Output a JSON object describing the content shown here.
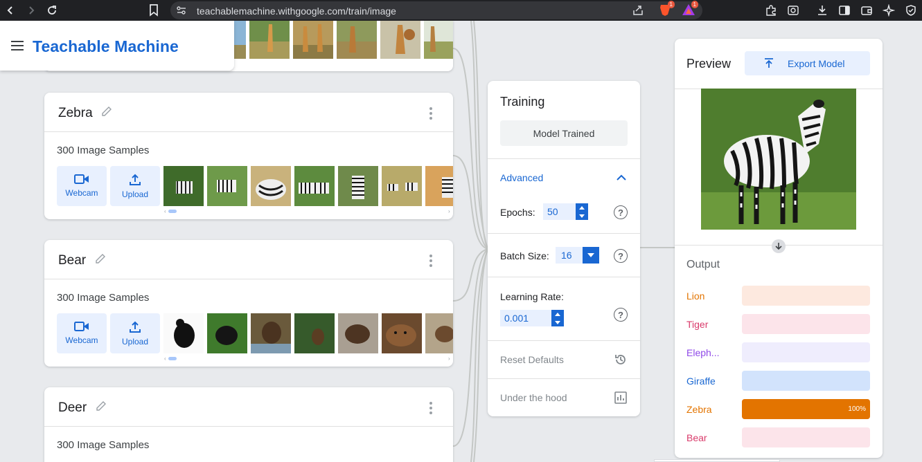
{
  "browser": {
    "url": "teachablemachine.withgoogle.com/train/image",
    "badge_brave": "1",
    "badge_ext": "1"
  },
  "header": {
    "brand": "Teachable Machine"
  },
  "classes": [
    {
      "name": "Zebra",
      "samples": "300 Image Samples",
      "webcam_label": "Webcam",
      "upload_label": "Upload"
    },
    {
      "name": "Bear",
      "samples": "300 Image Samples",
      "webcam_label": "Webcam",
      "upload_label": "Upload"
    },
    {
      "name": "Deer",
      "samples": "300 Image Samples"
    }
  ],
  "training": {
    "title": "Training",
    "trained_button": "Model Trained",
    "advanced_label": "Advanced",
    "epochs_label": "Epochs:",
    "epochs_value": "50",
    "batch_label": "Batch Size:",
    "batch_value": "16",
    "lr_label": "Learning Rate:",
    "lr_value": "0.001",
    "reset_label": "Reset Defaults",
    "hood_label": "Under the hood",
    "help_glyph": "?"
  },
  "preview": {
    "title": "Preview",
    "export_label": "Export Model",
    "output_title": "Output",
    "outputs": [
      {
        "label": "Lion",
        "value": 0,
        "color": "#e37400",
        "track": "#fde9df"
      },
      {
        "label": "Tiger",
        "value": 0,
        "color": "#d93b6b",
        "track": "#fce4ea"
      },
      {
        "label": "Eleph...",
        "value": 0,
        "color": "#8f49e8",
        "track": "#efedfd"
      },
      {
        "label": "Giraffe",
        "value": 0,
        "color": "#1967d2",
        "track": "#d2e3fc"
      },
      {
        "label": "Zebra",
        "value": 1.0,
        "pct_text": "100%",
        "color": "#e37400",
        "track": "#fde9df"
      },
      {
        "label": "Bear",
        "value": 0,
        "color": "#d93b6b",
        "track": "#fce4ea"
      }
    ]
  },
  "colors": {
    "brand_blue": "#1967d2",
    "light_blue": "#e8f0fe"
  }
}
